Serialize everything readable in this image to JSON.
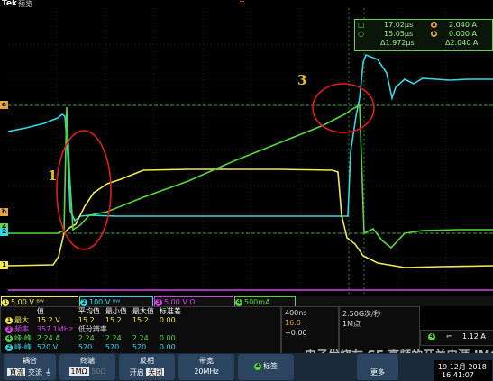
{
  "header": {
    "brand": "Tek",
    "mode": "预览",
    "trigger_marker": "T"
  },
  "cursor_readout": {
    "t1": "17.02μs",
    "t2": "15.05μs",
    "dt": "Δ1.972μs",
    "a_value": "2.040 A",
    "b_value": "0.000 A",
    "da": "Δ2.040 A",
    "a_label": "a",
    "b_label": "b"
  },
  "annotations": [
    "1",
    "3"
  ],
  "levels": {
    "a": "a",
    "b": "b",
    "ch4": "4",
    "ch2": "2",
    "ch1": "1"
  },
  "channels": [
    {
      "num": "1",
      "scale": "5.00 V",
      "color": "#f2e94e"
    },
    {
      "num": "2",
      "scale": "100 V",
      "color": "#2fd9e6"
    },
    {
      "num": "3",
      "scale": "5.00 V",
      "color": "#d544e6"
    },
    {
      "num": "4",
      "scale": "500mA",
      "color": "#57d83e"
    }
  ],
  "chbar_extras": {
    "ohm": "Ω",
    "ch1_bw": "ᴮᵂ",
    "ch2_bw": "ᴮᵂ"
  },
  "measurements": {
    "headers": [
      "值",
      "平均值",
      "最小值",
      "最大值",
      "标准差"
    ],
    "rows": [
      {
        "ch": "1",
        "name": "最大",
        "value": "15.2 V",
        "mean": "15.2",
        "min": "15.2",
        "max": "15.2",
        "std": "0.00",
        "color": "#f2e94e"
      },
      {
        "ch": "3",
        "name": "频率",
        "value": "357.1MHz",
        "mean": "低分辨率",
        "min": "",
        "max": "",
        "std": "",
        "color": "#d544e6"
      },
      {
        "ch": "4",
        "name": "峰-峰",
        "value": "2.24 A",
        "mean": "2.24",
        "min": "2.24",
        "max": "2.24",
        "std": "0.00",
        "color": "#57d83e"
      },
      {
        "ch": "2",
        "name": "峰-峰",
        "value": "520 V",
        "mean": "520",
        "min": "520",
        "max": "520",
        "std": "0.00",
        "color": "#2fd9e6"
      }
    ]
  },
  "acquisition": {
    "timebase": "400ns",
    "trigger_pos": "16.0",
    "delay": "+0.00"
  },
  "sample_rate": {
    "rate": "2.50G次/秒",
    "record": "1M点"
  },
  "trigger": {
    "ch": "4",
    "slope": "⌐",
    "level": "1.12 A"
  },
  "menu": {
    "coupling": {
      "title": "耦合",
      "dc": "直流",
      "ac": "交流"
    },
    "termination": {
      "title": "终端",
      "opt1": "1MΩ",
      "opt2": "50Ω"
    },
    "invert": {
      "title": "反相",
      "on": "开启",
      "off": "关闭"
    },
    "bandwidth": {
      "title": "带宽",
      "value": "20MHz"
    },
    "label": {
      "badge": "4",
      "title": "标签"
    },
    "more": {
      "title": "更多"
    }
  },
  "datetime": {
    "date": "19 12月 2018",
    "time": "16:41:07"
  },
  "watermark": "电子发烧友 SE 高频的开关电源 IMC"
}
